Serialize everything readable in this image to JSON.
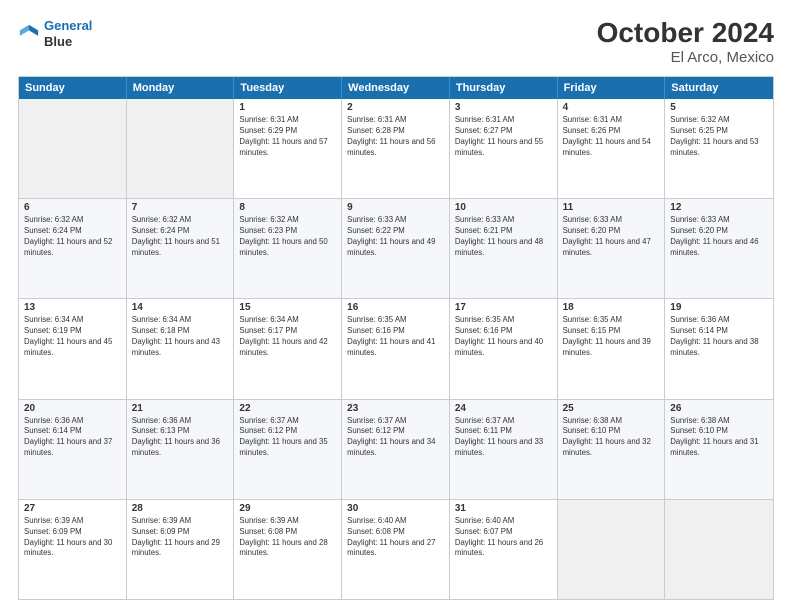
{
  "header": {
    "logo": {
      "line1": "General",
      "line2": "Blue"
    },
    "title": "October 2024",
    "subtitle": "El Arco, Mexico"
  },
  "calendar": {
    "days_of_week": [
      "Sunday",
      "Monday",
      "Tuesday",
      "Wednesday",
      "Thursday",
      "Friday",
      "Saturday"
    ],
    "weeks": [
      [
        {
          "day": "",
          "sunrise": "",
          "sunset": "",
          "daylight": "",
          "empty": true
        },
        {
          "day": "",
          "sunrise": "",
          "sunset": "",
          "daylight": "",
          "empty": true
        },
        {
          "day": "1",
          "sunrise": "Sunrise: 6:31 AM",
          "sunset": "Sunset: 6:29 PM",
          "daylight": "Daylight: 11 hours and 57 minutes.",
          "empty": false
        },
        {
          "day": "2",
          "sunrise": "Sunrise: 6:31 AM",
          "sunset": "Sunset: 6:28 PM",
          "daylight": "Daylight: 11 hours and 56 minutes.",
          "empty": false
        },
        {
          "day": "3",
          "sunrise": "Sunrise: 6:31 AM",
          "sunset": "Sunset: 6:27 PM",
          "daylight": "Daylight: 11 hours and 55 minutes.",
          "empty": false
        },
        {
          "day": "4",
          "sunrise": "Sunrise: 6:31 AM",
          "sunset": "Sunset: 6:26 PM",
          "daylight": "Daylight: 11 hours and 54 minutes.",
          "empty": false
        },
        {
          "day": "5",
          "sunrise": "Sunrise: 6:32 AM",
          "sunset": "Sunset: 6:25 PM",
          "daylight": "Daylight: 11 hours and 53 minutes.",
          "empty": false
        }
      ],
      [
        {
          "day": "6",
          "sunrise": "Sunrise: 6:32 AM",
          "sunset": "Sunset: 6:24 PM",
          "daylight": "Daylight: 11 hours and 52 minutes.",
          "empty": false
        },
        {
          "day": "7",
          "sunrise": "Sunrise: 6:32 AM",
          "sunset": "Sunset: 6:24 PM",
          "daylight": "Daylight: 11 hours and 51 minutes.",
          "empty": false
        },
        {
          "day": "8",
          "sunrise": "Sunrise: 6:32 AM",
          "sunset": "Sunset: 6:23 PM",
          "daylight": "Daylight: 11 hours and 50 minutes.",
          "empty": false
        },
        {
          "day": "9",
          "sunrise": "Sunrise: 6:33 AM",
          "sunset": "Sunset: 6:22 PM",
          "daylight": "Daylight: 11 hours and 49 minutes.",
          "empty": false
        },
        {
          "day": "10",
          "sunrise": "Sunrise: 6:33 AM",
          "sunset": "Sunset: 6:21 PM",
          "daylight": "Daylight: 11 hours and 48 minutes.",
          "empty": false
        },
        {
          "day": "11",
          "sunrise": "Sunrise: 6:33 AM",
          "sunset": "Sunset: 6:20 PM",
          "daylight": "Daylight: 11 hours and 47 minutes.",
          "empty": false
        },
        {
          "day": "12",
          "sunrise": "Sunrise: 6:33 AM",
          "sunset": "Sunset: 6:20 PM",
          "daylight": "Daylight: 11 hours and 46 minutes.",
          "empty": false
        }
      ],
      [
        {
          "day": "13",
          "sunrise": "Sunrise: 6:34 AM",
          "sunset": "Sunset: 6:19 PM",
          "daylight": "Daylight: 11 hours and 45 minutes.",
          "empty": false
        },
        {
          "day": "14",
          "sunrise": "Sunrise: 6:34 AM",
          "sunset": "Sunset: 6:18 PM",
          "daylight": "Daylight: 11 hours and 43 minutes.",
          "empty": false
        },
        {
          "day": "15",
          "sunrise": "Sunrise: 6:34 AM",
          "sunset": "Sunset: 6:17 PM",
          "daylight": "Daylight: 11 hours and 42 minutes.",
          "empty": false
        },
        {
          "day": "16",
          "sunrise": "Sunrise: 6:35 AM",
          "sunset": "Sunset: 6:16 PM",
          "daylight": "Daylight: 11 hours and 41 minutes.",
          "empty": false
        },
        {
          "day": "17",
          "sunrise": "Sunrise: 6:35 AM",
          "sunset": "Sunset: 6:16 PM",
          "daylight": "Daylight: 11 hours and 40 minutes.",
          "empty": false
        },
        {
          "day": "18",
          "sunrise": "Sunrise: 6:35 AM",
          "sunset": "Sunset: 6:15 PM",
          "daylight": "Daylight: 11 hours and 39 minutes.",
          "empty": false
        },
        {
          "day": "19",
          "sunrise": "Sunrise: 6:36 AM",
          "sunset": "Sunset: 6:14 PM",
          "daylight": "Daylight: 11 hours and 38 minutes.",
          "empty": false
        }
      ],
      [
        {
          "day": "20",
          "sunrise": "Sunrise: 6:36 AM",
          "sunset": "Sunset: 6:14 PM",
          "daylight": "Daylight: 11 hours and 37 minutes.",
          "empty": false
        },
        {
          "day": "21",
          "sunrise": "Sunrise: 6:36 AM",
          "sunset": "Sunset: 6:13 PM",
          "daylight": "Daylight: 11 hours and 36 minutes.",
          "empty": false
        },
        {
          "day": "22",
          "sunrise": "Sunrise: 6:37 AM",
          "sunset": "Sunset: 6:12 PM",
          "daylight": "Daylight: 11 hours and 35 minutes.",
          "empty": false
        },
        {
          "day": "23",
          "sunrise": "Sunrise: 6:37 AM",
          "sunset": "Sunset: 6:12 PM",
          "daylight": "Daylight: 11 hours and 34 minutes.",
          "empty": false
        },
        {
          "day": "24",
          "sunrise": "Sunrise: 6:37 AM",
          "sunset": "Sunset: 6:11 PM",
          "daylight": "Daylight: 11 hours and 33 minutes.",
          "empty": false
        },
        {
          "day": "25",
          "sunrise": "Sunrise: 6:38 AM",
          "sunset": "Sunset: 6:10 PM",
          "daylight": "Daylight: 11 hours and 32 minutes.",
          "empty": false
        },
        {
          "day": "26",
          "sunrise": "Sunrise: 6:38 AM",
          "sunset": "Sunset: 6:10 PM",
          "daylight": "Daylight: 11 hours and 31 minutes.",
          "empty": false
        }
      ],
      [
        {
          "day": "27",
          "sunrise": "Sunrise: 6:39 AM",
          "sunset": "Sunset: 6:09 PM",
          "daylight": "Daylight: 11 hours and 30 minutes.",
          "empty": false
        },
        {
          "day": "28",
          "sunrise": "Sunrise: 6:39 AM",
          "sunset": "Sunset: 6:09 PM",
          "daylight": "Daylight: 11 hours and 29 minutes.",
          "empty": false
        },
        {
          "day": "29",
          "sunrise": "Sunrise: 6:39 AM",
          "sunset": "Sunset: 6:08 PM",
          "daylight": "Daylight: 11 hours and 28 minutes.",
          "empty": false
        },
        {
          "day": "30",
          "sunrise": "Sunrise: 6:40 AM",
          "sunset": "Sunset: 6:08 PM",
          "daylight": "Daylight: 11 hours and 27 minutes.",
          "empty": false
        },
        {
          "day": "31",
          "sunrise": "Sunrise: 6:40 AM",
          "sunset": "Sunset: 6:07 PM",
          "daylight": "Daylight: 11 hours and 26 minutes.",
          "empty": false
        },
        {
          "day": "",
          "sunrise": "",
          "sunset": "",
          "daylight": "",
          "empty": true
        },
        {
          "day": "",
          "sunrise": "",
          "sunset": "",
          "daylight": "",
          "empty": true
        }
      ]
    ]
  }
}
